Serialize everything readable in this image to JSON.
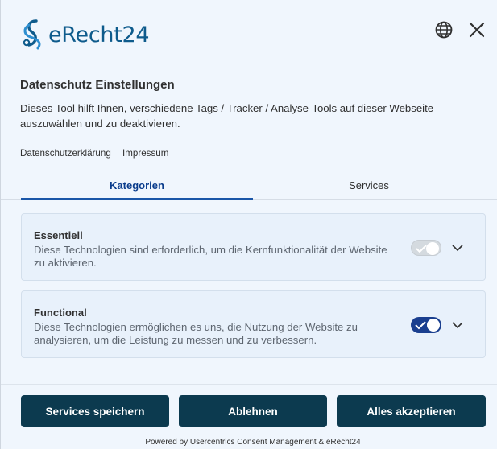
{
  "logo": {
    "text": "eRecht24",
    "mark": "erecht24-logo-mark"
  },
  "header": {
    "language_icon": "globe-icon",
    "close_icon": "close-icon"
  },
  "title": "Datenschutz Einstellungen",
  "description": "Dieses Tool hilft Ihnen, verschiedene Tags / Tracker / Analyse-Tools auf dieser Webseite auszuwählen und zu deaktivieren.",
  "links": {
    "privacy": "Datenschutzerklärung",
    "imprint": "Impressum"
  },
  "tabs": [
    {
      "label": "Kategorien",
      "active": true
    },
    {
      "label": "Services",
      "active": false
    }
  ],
  "categories": [
    {
      "title": "Essentiell",
      "description": "Diese Technologien sind erforderlich, um die Kernfunktionalität der Website zu aktivieren.",
      "enabled": true,
      "disabled": true
    },
    {
      "title": "Functional",
      "description": "Diese Technologien ermöglichen es uns, die Nutzung der Website zu analysieren, um die Leistung zu messen und zu verbessern.",
      "enabled": true,
      "disabled": false
    }
  ],
  "buttons": {
    "save": "Services speichern",
    "deny": "Ablehnen",
    "accept_all": "Alles akzeptieren"
  },
  "powered_by": "Powered by Usercentrics Consent Management & eRecht24",
  "colors": {
    "background": "#f0f6fd",
    "primary_button": "#0c3a4f",
    "tab_active": "#0a3c8c",
    "toggle_on": "#1a3f8f",
    "logo": "#0e5b8c",
    "card": "#e8f1fb"
  }
}
